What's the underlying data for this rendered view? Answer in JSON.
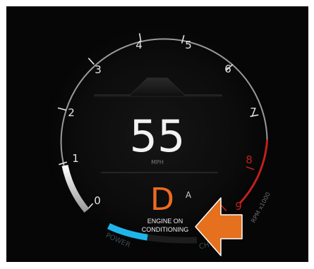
{
  "tachometer": {
    "ticks": [
      "0",
      "1",
      "2",
      "3",
      "4",
      "5",
      "6",
      "7",
      "8",
      "9"
    ],
    "unit_label": "RPM x1000",
    "rpm_level_fraction": 0.1,
    "redline_color": "#c0201e",
    "tick_color": "#e6e6e6"
  },
  "speed": {
    "value": "55",
    "unit": "MPH",
    "color": "#f2f2f2"
  },
  "gear": {
    "selected": "D",
    "mode": "A",
    "color": "#ee6b1e"
  },
  "notice": {
    "line1": "ENGINE ON",
    "line2": "CONDITIONING"
  },
  "power_gauge": {
    "label": "POWER",
    "right_label": "CH",
    "level_fraction": 0.45,
    "color": "#1eb6ea"
  },
  "arrow": {
    "icon": "arrow-left-icon",
    "color": "#e5701d"
  }
}
